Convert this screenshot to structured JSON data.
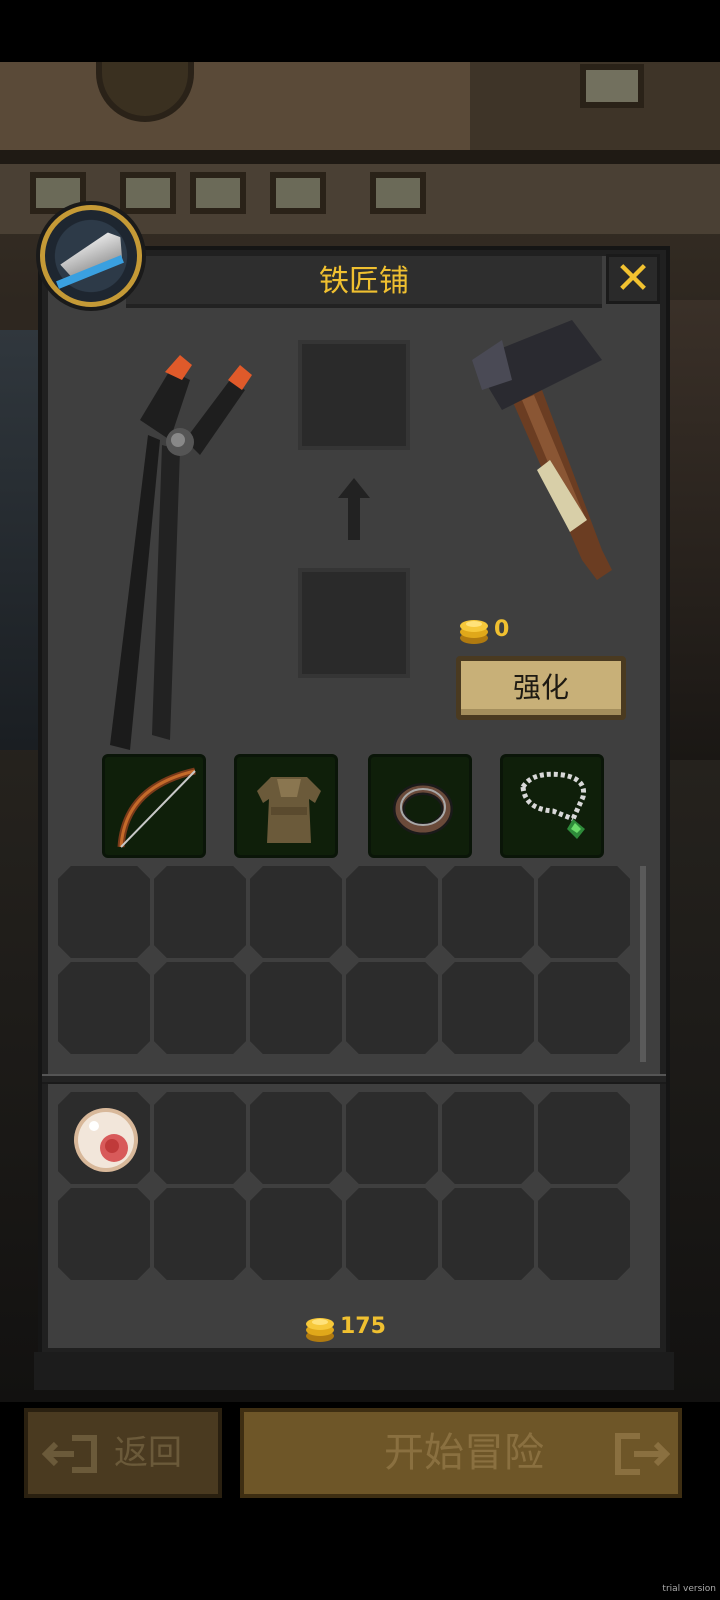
{
  "header": {
    "title": "铁匠铺",
    "close_icon": "close-icon"
  },
  "forge": {
    "cost": "0",
    "enhance_label": "强化",
    "tools": [
      "pliers-icon",
      "hammer-icon"
    ],
    "arrow_icon": "arrow-up-icon"
  },
  "equipment": [
    {
      "name": "bow",
      "icon": "bow-icon"
    },
    {
      "name": "armor",
      "icon": "armor-icon"
    },
    {
      "name": "ring",
      "icon": "ring-icon"
    },
    {
      "name": "necklace",
      "icon": "necklace-icon"
    }
  ],
  "inventory": {
    "equip_grid": {
      "rows": 2,
      "cols": 6
    },
    "item_grid": {
      "rows": 2,
      "cols": 6,
      "items": [
        {
          "slot": 0,
          "icon": "meat-icon"
        }
      ]
    }
  },
  "gold": "175",
  "footer": {
    "back_label": "返回",
    "start_label": "开始冒险"
  },
  "watermark": "trial version",
  "colors": {
    "gold_text": "#f0c030",
    "panel": "#3f3f3f",
    "equip_bg": "#0f1f0a",
    "button_tan": "#c8b078",
    "start_button": "#6e5628"
  }
}
